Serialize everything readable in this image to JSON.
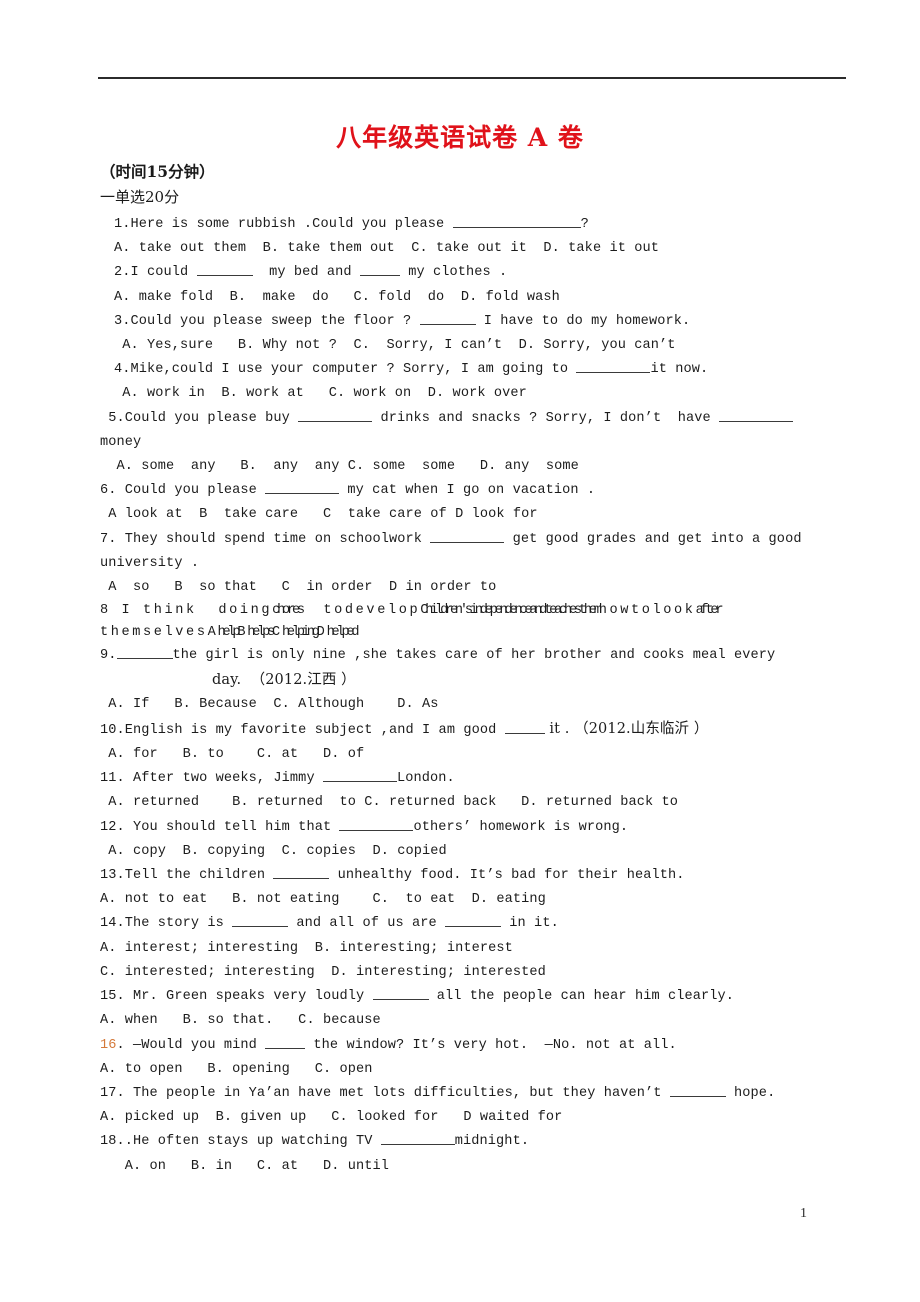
{
  "document": {
    "title": "八年级英语试卷 A 卷",
    "title_color": "#e0121a",
    "time_note": "（时间15分钟）",
    "section_heading": "一单选20分",
    "page_number": "1",
    "accent_color": "#d4793a",
    "rule_color": "#2b2b2b"
  },
  "questions": [
    {
      "id": "q1",
      "stem": "1.Here is some rubbish .Could you please ",
      "stem_tail": "?",
      "options": "A. take out them  B. take them out  C. take out it  D. take it out"
    },
    {
      "id": "q2",
      "stem_a": "2.I could ",
      "stem_b": "  my bed and ",
      "stem_c": " my clothes .",
      "options": "A. make fold  B.  make  do   C. fold  do  D. fold wash"
    },
    {
      "id": "q3",
      "stem_a": "3.Could you please sweep the floor ? ",
      "stem_b": " I have to do my homework.",
      "options": " A. Yes,sure   B. Why not ?  C.  Sorry, I can’t  D. Sorry, you can’t"
    },
    {
      "id": "q4",
      "stem_a": "4.Mike,could I use your computer ? Sorry, I am going to ",
      "stem_b": "it now.",
      "options": " A. work in  B. work at   C. work on  D. work over"
    },
    {
      "id": "q5",
      "stem_a": " 5.Could you please buy ",
      "stem_b": " drinks and snacks ? Sorry, I don’t  have ",
      "stem_wrap": "money",
      "options": "  A. some  any   B.  any  any C. some  some   D. any  some"
    },
    {
      "id": "q6",
      "stem_a": "6. Could you please ",
      "stem_b": " my cat when I go on vacation .",
      "options": " A look at  B  take care   C  take care of D look for"
    },
    {
      "id": "q7",
      "stem_a": "7. They should spend time on schoolwork ",
      "stem_b": " get good grades and get into a good",
      "stem_wrap": "university .",
      "options": " A  so   B  so that   C  in order  D in order to"
    },
    {
      "id": "q8",
      "line1_a": "8 I think",
      "line1_b": "doing",
      "line1_c": "chores",
      "line1_d": "to",
      "line1_e": "develop",
      "line1_f": "Children's",
      "line1_g": "independence",
      "line1_h": "and",
      "line1_i": "teaches",
      "line1_j": "them",
      "line1_k": "how",
      "line1_l": "to",
      "line1_m": "look",
      "line1_n": "after",
      "line2_a": "themselves",
      "line2_b": "A help",
      "line2_c": "B helps",
      "line2_d": "C helping",
      "line2_e": "D helped"
    },
    {
      "id": "q9",
      "stem_a": "9.",
      "stem_b": "the girl is only nine ,she takes care of her brother and cooks meal every",
      "stem_wrap": "day.  （2012.江西 ）",
      "options": " A. If   B. Because  C. Although    D. As"
    },
    {
      "id": "q10",
      "stem_a": "10.English is my favorite subject ,and I am good ",
      "stem_b": " it . （2012.山东临沂 ）",
      "options": " A. for   B. to    C. at   D. of"
    },
    {
      "id": "q11",
      "stem_a": "11. After two weeks, Jimmy ",
      "stem_b": "London.",
      "options": " A. returned    B. returned  to C. returned back   D. returned back to"
    },
    {
      "id": "q12",
      "stem_a": "12. You should tell him that ",
      "stem_b": "others’ homework is wrong.",
      "options": " A. copy  B. copying  C. copies  D. copied"
    },
    {
      "id": "q13",
      "stem_a": "13.Tell the children ",
      "stem_b": " unhealthy food. It’s bad for their health.",
      "options": "A. not to eat   B. not eating    C.  to eat  D. eating"
    },
    {
      "id": "q14",
      "stem_a": "14.The story is ",
      "stem_b": " and all of us are ",
      "stem_c": " in it.",
      "options_a": "A. interest; interesting  B. interesting; interest",
      "options_b": "C. interested; interesting  D. interesting; interested"
    },
    {
      "id": "q15",
      "stem_a": "15. Mr. Green speaks very loudly ",
      "stem_b": " all the people can hear him clearly.",
      "options": "A. when   B. so that.   C. because"
    },
    {
      "id": "q16",
      "number": "16",
      "stem_a": ". —Would you mind ",
      "stem_b": " the window? It’s very hot.  —No. not at all.",
      "options": "A. to open   B. opening   C. open"
    },
    {
      "id": "q17",
      "stem_a": "17. The people in Ya’an have met lots difficulties, but they haven’t ",
      "stem_b": " hope.",
      "options": "A. picked up  B. given up   C. looked for   D waited for"
    },
    {
      "id": "q18",
      "stem_a": "18..He often stays up watching TV ",
      "stem_b": "midnight.",
      "options": "   A. on   B. in   C. at   D. until"
    }
  ]
}
